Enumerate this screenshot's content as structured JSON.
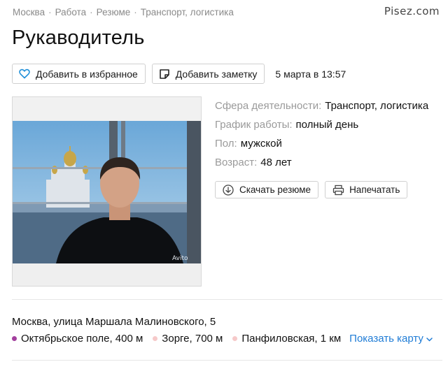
{
  "watermark": "Pisez.com",
  "breadcrumb": {
    "items": [
      "Москва",
      "Работа",
      "Резюме",
      "Транспорт, логистика"
    ],
    "separator": "·"
  },
  "title": "Рукаводитель",
  "actions": {
    "favorite_label": "Добавить в избранное",
    "favorite_icon": "heart-icon",
    "note_label": "Добавить заметку",
    "note_icon": "note-icon",
    "date": "5 марта в 13:57"
  },
  "photo": {
    "alt_icon": "profile-photo",
    "watermark_text": "Avito"
  },
  "properties": [
    {
      "key": "Сфера деятельности:",
      "value": "Транспорт, логистика"
    },
    {
      "key": "График работы:",
      "value": "полный день"
    },
    {
      "key": "Пол:",
      "value": "мужской"
    },
    {
      "key": "Возраст:",
      "value": "48 лет"
    }
  ],
  "resume_actions": {
    "download_label": "Скачать резюме",
    "download_icon": "download-icon",
    "print_label": "Напечатать",
    "print_icon": "printer-icon"
  },
  "location": {
    "address": "Москва, улица Маршала Малиновского, 5",
    "metro": [
      {
        "name": "Октябрьское поле, 400 м",
        "color": "#a33f9e"
      },
      {
        "name": "Зорге, 700 м",
        "color": "#f6c9c9"
      },
      {
        "name": "Панфиловская, 1 км",
        "color": "#f6c9c9"
      }
    ],
    "map_link": "Показать карту"
  },
  "colors": {
    "accent_link": "#1f7cd6",
    "favorite_icon": "#1f8fd8"
  }
}
